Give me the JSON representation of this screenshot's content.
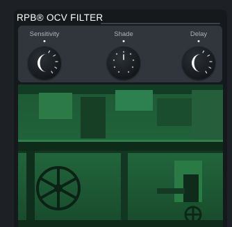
{
  "header": {
    "title": "RPB® OCV FILTER"
  },
  "controls": [
    {
      "label": "Sensitivity",
      "icon": "crescent-moon-icon"
    },
    {
      "label": "Shade",
      "icon": "shade-dial-icon"
    },
    {
      "label": "Delay",
      "icon": "crescent-moon-icon"
    }
  ],
  "colors": {
    "accent": "#ffffff",
    "panel": "#30363b",
    "video_tint": "#1e6a3a"
  }
}
